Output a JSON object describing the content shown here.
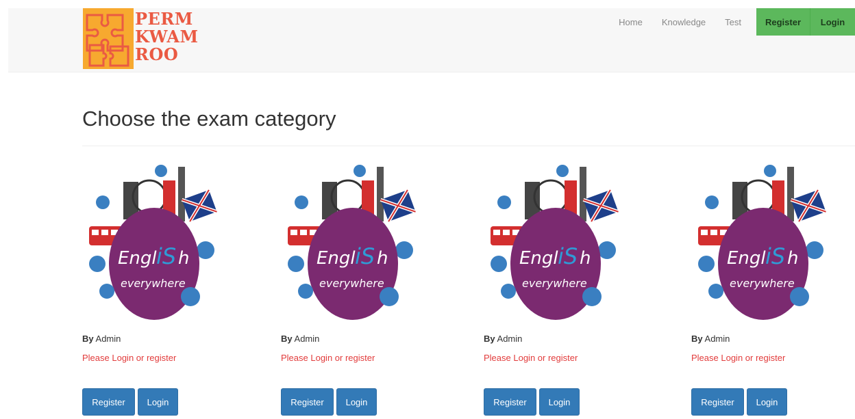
{
  "brand": {
    "line1": "PERM",
    "line2": "KWAM",
    "line3": "ROO"
  },
  "nav": {
    "links": [
      "Home",
      "Knowledge",
      "Test"
    ],
    "register_label": "Register",
    "login_label": "Login"
  },
  "page": {
    "title": "Choose the exam category"
  },
  "cards": [
    {
      "logo_word_left": "Engl",
      "logo_word_mid": "iS",
      "logo_word_right": "h",
      "logo_sub": "everywhere",
      "by_label": "By",
      "author": "Admin",
      "notice": "Please Login or register",
      "register_label": "Register",
      "login_label": "Login"
    },
    {
      "logo_word_left": "Engl",
      "logo_word_mid": "iS",
      "logo_word_right": "h",
      "logo_sub": "everywhere",
      "by_label": "By",
      "author": "Admin",
      "notice": "Please Login or register",
      "register_label": "Register",
      "login_label": "Login"
    },
    {
      "logo_word_left": "Engl",
      "logo_word_mid": "iS",
      "logo_word_right": "h",
      "logo_sub": "everywhere",
      "by_label": "By",
      "author": "Admin",
      "notice": "Please Login or register",
      "register_label": "Register",
      "login_label": "Login"
    },
    {
      "logo_word_left": "Engl",
      "logo_word_mid": "iS",
      "logo_word_right": "h",
      "logo_sub": "everywhere",
      "by_label": "By",
      "author": "Admin",
      "notice": "Please Login or register",
      "register_label": "Register",
      "login_label": "Login"
    }
  ],
  "colors": {
    "nav_green": "#5cb85c",
    "primary_blue": "#337ab7",
    "notice_red": "#e23b3b",
    "brand_orange": "#f7a92f",
    "brand_text": "#ea5a43",
    "logo_purple": "#7b2a70"
  }
}
